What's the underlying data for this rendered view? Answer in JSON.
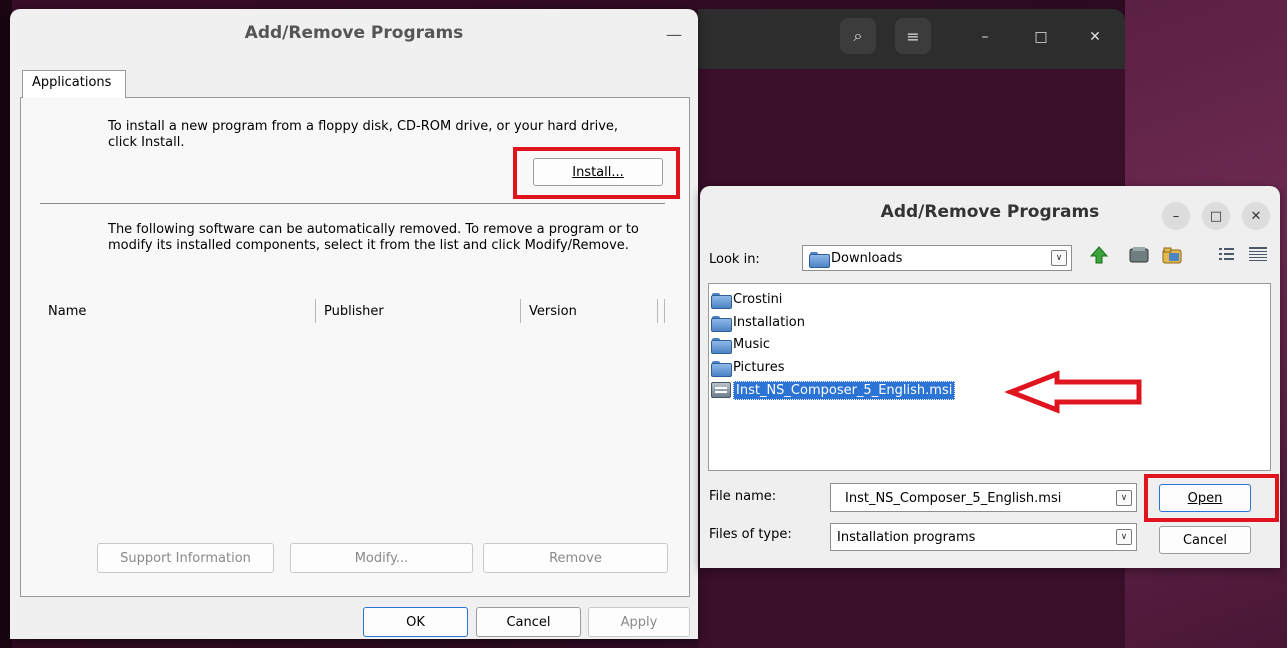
{
  "colors": {
    "highlight_red": "#e0141e",
    "selection_blue": "#2b73d4"
  },
  "terminal": {
    "buttons": [
      "search-icon",
      "menu-icon"
    ],
    "controls": [
      "minimize-icon",
      "maximize-icon",
      "close-icon"
    ]
  },
  "left_dialog": {
    "title": "Add/Remove Programs",
    "tab": "Applications",
    "install_text": "To install a new program from a floppy disk, CD-ROM drive, or your hard drive, click Install.",
    "install_button": "Install...",
    "remove_text": "The following software can be automatically removed. To remove a program or to modify its installed components, select it from the list and click Modify/Remove.",
    "columns": [
      "Name",
      "Publisher",
      "Version"
    ],
    "action_buttons": {
      "support": "Support Information",
      "modify": "Modify...",
      "remove": "Remove"
    },
    "footer_buttons": {
      "ok": "OK",
      "cancel": "Cancel",
      "apply": "Apply"
    }
  },
  "file_dialog": {
    "title": "Add/Remove Programs",
    "look_in_label": "Look in:",
    "look_in_value": "Downloads",
    "toolbar_icons": [
      "up-folder-icon",
      "desktop-icon",
      "new-folder-icon",
      "list-view-icon",
      "details-view-icon"
    ],
    "files": [
      {
        "name": "Crostini",
        "type": "folder"
      },
      {
        "name": "Installation",
        "type": "folder"
      },
      {
        "name": "Music",
        "type": "folder"
      },
      {
        "name": "Pictures",
        "type": "folder"
      },
      {
        "name": "Inst_NS_Composer_5_English.msi",
        "type": "msi",
        "selected": true
      }
    ],
    "file_name_label": "File name:",
    "file_name_value": "Inst_NS_Composer_5_English.msi",
    "files_of_type_label": "Files of type:",
    "files_of_type_value": "Installation programs",
    "open_button": "Open",
    "cancel_button": "Cancel"
  }
}
